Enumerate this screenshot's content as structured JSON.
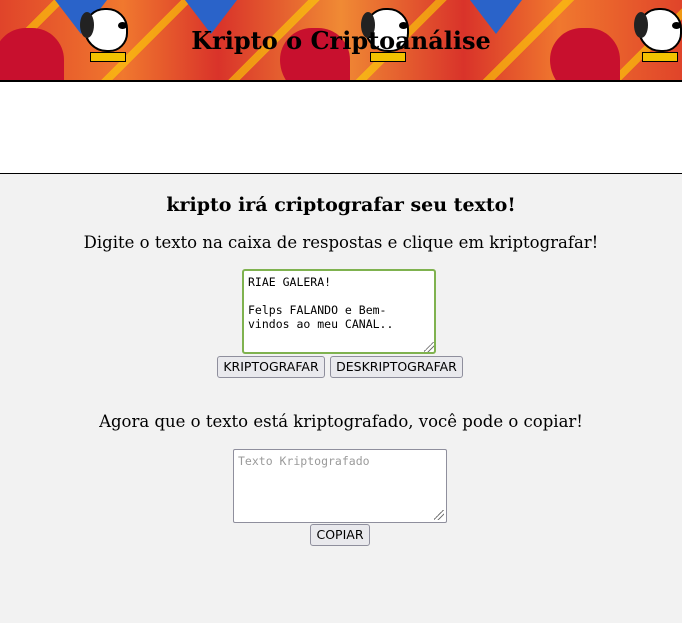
{
  "header": {
    "title": "Kripto o Criptoanálise"
  },
  "main": {
    "heading": "kripto irá criptografar seu texto!",
    "instructions": "Digite o texto na caixa de respostas e clique em kriptografar!",
    "input_value": "RIAE GALERA!\n\nFelps FALANDO e Bem-\nvindos ao meu CANAL..",
    "encrypt_label": "KRIPTOGRAFAR",
    "decrypt_label": "DESKRIPTOGRAFAR",
    "note": "Agora que o texto está kriptografado, você pode o copiar!",
    "output_placeholder": "Texto Kriptografado",
    "copy_label": "COPIAR"
  },
  "colors": {
    "banner_red": "#e0442a",
    "input_focus_border": "#7fb24f",
    "page_background": "#f2f2f2"
  },
  "icons": {
    "banner_image": "krypto-superdog-banner",
    "resize_grip": "resize-grip-icon"
  }
}
